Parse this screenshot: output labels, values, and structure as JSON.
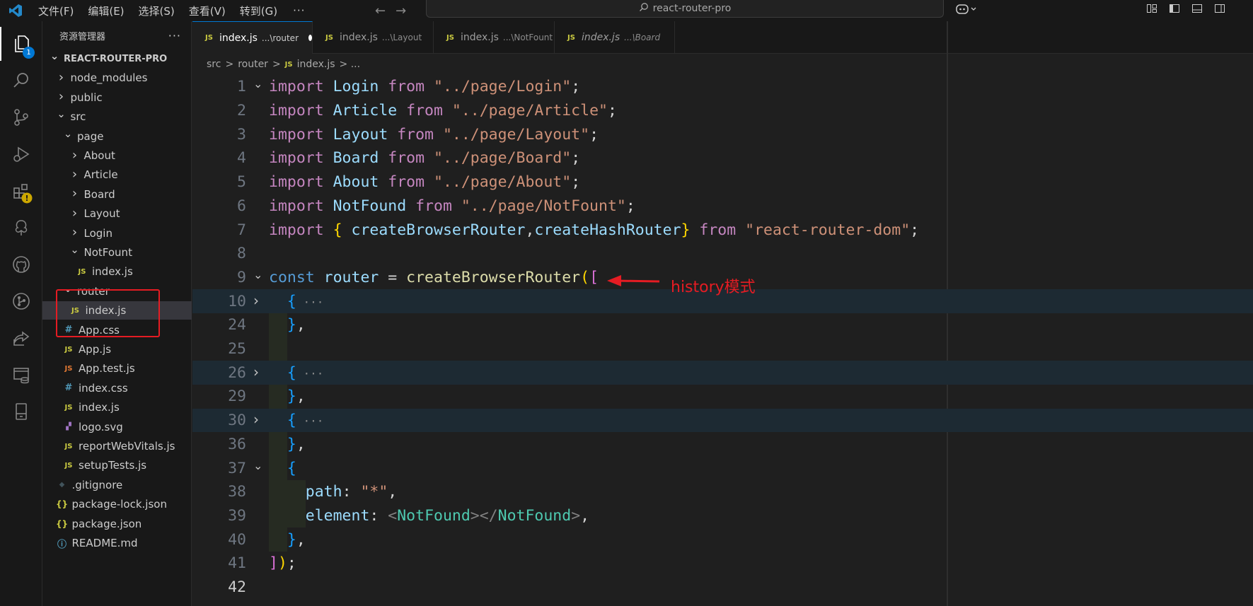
{
  "titlebar": {
    "menus": [
      "文件(F)",
      "编辑(E)",
      "选择(S)",
      "查看(V)",
      "转到(G)"
    ],
    "more": "···",
    "search_text": "react-router-pro"
  },
  "activity": {
    "explorer_badge": "1"
  },
  "sidebar": {
    "header": "资源管理器",
    "more": "···",
    "tree": [
      {
        "label": "REACT-ROUTER-PRO",
        "depth": 0,
        "chevron": "open",
        "icon": "",
        "root": true
      },
      {
        "label": "node_modules",
        "depth": 1,
        "chevron": "closed",
        "icon": ""
      },
      {
        "label": "public",
        "depth": 1,
        "chevron": "closed",
        "icon": ""
      },
      {
        "label": "src",
        "depth": 1,
        "chevron": "open",
        "icon": ""
      },
      {
        "label": "page",
        "depth": 2,
        "chevron": "open",
        "icon": ""
      },
      {
        "label": "About",
        "depth": 3,
        "chevron": "closed",
        "icon": ""
      },
      {
        "label": "Article",
        "depth": 3,
        "chevron": "closed",
        "icon": ""
      },
      {
        "label": "Board",
        "depth": 3,
        "chevron": "closed",
        "icon": ""
      },
      {
        "label": "Layout",
        "depth": 3,
        "chevron": "closed",
        "icon": ""
      },
      {
        "label": "Login",
        "depth": 3,
        "chevron": "closed",
        "icon": ""
      },
      {
        "label": "NotFount",
        "depth": 3,
        "chevron": "open",
        "icon": ""
      },
      {
        "label": "index.js",
        "depth": 4,
        "chevron": "",
        "icon": "js"
      },
      {
        "label": "router",
        "depth": 2,
        "chevron": "open",
        "icon": ""
      },
      {
        "label": "index.js",
        "depth": 3,
        "chevron": "",
        "icon": "js",
        "selected": true
      },
      {
        "label": "App.css",
        "depth": 2,
        "chevron": "",
        "icon": "css"
      },
      {
        "label": "App.js",
        "depth": 2,
        "chevron": "",
        "icon": "js"
      },
      {
        "label": "App.test.js",
        "depth": 2,
        "chevron": "",
        "icon": "jsorange"
      },
      {
        "label": "index.css",
        "depth": 2,
        "chevron": "",
        "icon": "css"
      },
      {
        "label": "index.js",
        "depth": 2,
        "chevron": "",
        "icon": "js"
      },
      {
        "label": "logo.svg",
        "depth": 2,
        "chevron": "",
        "icon": "svg"
      },
      {
        "label": "reportWebVitals.js",
        "depth": 2,
        "chevron": "",
        "icon": "js"
      },
      {
        "label": "setupTests.js",
        "depth": 2,
        "chevron": "",
        "icon": "js"
      },
      {
        "label": ".gitignore",
        "depth": 1,
        "chevron": "",
        "icon": "git"
      },
      {
        "label": "package-lock.json",
        "depth": 1,
        "chevron": "",
        "icon": "json"
      },
      {
        "label": "package.json",
        "depth": 1,
        "chevron": "",
        "icon": "json"
      },
      {
        "label": "README.md",
        "depth": 1,
        "chevron": "",
        "icon": "info"
      }
    ],
    "icon_glyphs": {
      "js": "JS",
      "css": "#",
      "jsorange": "JS",
      "svg": "▞",
      "git": "◆",
      "json": "{}",
      "info": "ⓘ"
    }
  },
  "tabs": [
    {
      "name": "index.js",
      "path": "...\\router",
      "active": true,
      "dirty": true
    },
    {
      "name": "index.js",
      "path": "...\\Layout"
    },
    {
      "name": "index.js",
      "path": "...\\NotFount"
    },
    {
      "name": "index.js",
      "path": "...\\Board",
      "italic": true
    }
  ],
  "breadcrumb": {
    "parts": [
      "src",
      ">",
      "router",
      ">"
    ],
    "js_badge": "JS",
    "file": "index.js",
    "tail": "> ..."
  },
  "code": [
    {
      "n": "1",
      "fold": "open",
      "t": [
        [
          "kw",
          "import "
        ],
        [
          "id",
          "Login "
        ],
        [
          "kw",
          "from "
        ],
        [
          "str",
          "\"../page/Login\""
        ],
        [
          "pl",
          ";"
        ]
      ]
    },
    {
      "n": "2",
      "fold": "",
      "t": [
        [
          "kw",
          "import "
        ],
        [
          "id",
          "Article "
        ],
        [
          "kw",
          "from "
        ],
        [
          "str",
          "\"../page/Article\""
        ],
        [
          "pl",
          ";"
        ]
      ]
    },
    {
      "n": "3",
      "fold": "",
      "t": [
        [
          "kw",
          "import "
        ],
        [
          "id",
          "Layout "
        ],
        [
          "kw",
          "from "
        ],
        [
          "str",
          "\"../page/Layout\""
        ],
        [
          "pl",
          ";"
        ]
      ]
    },
    {
      "n": "4",
      "fold": "",
      "t": [
        [
          "kw",
          "import "
        ],
        [
          "id",
          "Board "
        ],
        [
          "kw",
          "from "
        ],
        [
          "str",
          "\"../page/Board\""
        ],
        [
          "pl",
          ";"
        ]
      ]
    },
    {
      "n": "5",
      "fold": "",
      "t": [
        [
          "kw",
          "import "
        ],
        [
          "id",
          "About "
        ],
        [
          "kw",
          "from "
        ],
        [
          "str",
          "\"../page/About\""
        ],
        [
          "pl",
          ";"
        ]
      ]
    },
    {
      "n": "6",
      "fold": "",
      "t": [
        [
          "kw",
          "import "
        ],
        [
          "id",
          "NotFound "
        ],
        [
          "kw",
          "from "
        ],
        [
          "str",
          "\"../page/NotFount\""
        ],
        [
          "pl",
          ";"
        ]
      ]
    },
    {
      "n": "7",
      "fold": "",
      "t": [
        [
          "kw",
          "import "
        ],
        [
          "br1",
          "{ "
        ],
        [
          "id",
          "createBrowserRouter"
        ],
        [
          "pl",
          ","
        ],
        [
          "id",
          "createHashRouter"
        ],
        [
          "br1",
          "} "
        ],
        [
          "kw",
          "from "
        ],
        [
          "str",
          "\"react-router-dom\""
        ],
        [
          "pl",
          ";"
        ]
      ]
    },
    {
      "n": "8",
      "fold": "",
      "t": []
    },
    {
      "n": "9",
      "fold": "open",
      "t": [
        [
          "kwb",
          "const "
        ],
        [
          "id",
          "router "
        ],
        [
          "pl",
          "= "
        ],
        [
          "fn",
          "createBrowserRouter"
        ],
        [
          "br1",
          "("
        ],
        [
          "br2",
          "["
        ]
      ]
    },
    {
      "n": "10",
      "fold": "closed",
      "hl": true,
      "t": [
        [
          "pl",
          "  "
        ],
        [
          "br3",
          "{"
        ],
        [
          "ell",
          " ···"
        ]
      ]
    },
    {
      "n": "24",
      "fold": "",
      "t": [
        [
          "pl",
          "  "
        ],
        [
          "br3",
          "}"
        ],
        [
          "pl",
          ","
        ]
      ]
    },
    {
      "n": "25",
      "fold": "",
      "t": []
    },
    {
      "n": "26",
      "fold": "closed",
      "hl": true,
      "t": [
        [
          "pl",
          "  "
        ],
        [
          "br3",
          "{"
        ],
        [
          "ell",
          " ···"
        ]
      ]
    },
    {
      "n": "29",
      "fold": "",
      "t": [
        [
          "pl",
          "  "
        ],
        [
          "br3",
          "}"
        ],
        [
          "pl",
          ","
        ]
      ]
    },
    {
      "n": "30",
      "fold": "closed",
      "hl": true,
      "t": [
        [
          "pl",
          "  "
        ],
        [
          "br3",
          "{"
        ],
        [
          "ell",
          " ···"
        ]
      ]
    },
    {
      "n": "36",
      "fold": "",
      "t": [
        [
          "pl",
          "  "
        ],
        [
          "br3",
          "}"
        ],
        [
          "pl",
          ","
        ]
      ]
    },
    {
      "n": "37",
      "fold": "open",
      "t": [
        [
          "pl",
          "  "
        ],
        [
          "br3",
          "{"
        ]
      ]
    },
    {
      "n": "38",
      "fold": "",
      "t": [
        [
          "pl",
          "    "
        ],
        [
          "id",
          "path"
        ],
        [
          "pl",
          ": "
        ],
        [
          "str",
          "\"*\""
        ],
        [
          "pl",
          ","
        ]
      ]
    },
    {
      "n": "39",
      "fold": "",
      "t": [
        [
          "pl",
          "    "
        ],
        [
          "id",
          "element"
        ],
        [
          "pl",
          ": "
        ],
        [
          "tagp",
          "<"
        ],
        [
          "tag",
          "NotFound"
        ],
        [
          "tagp",
          "></"
        ],
        [
          "tag",
          "NotFound"
        ],
        [
          "tagp",
          ">"
        ],
        [
          "pl",
          ","
        ]
      ]
    },
    {
      "n": "40",
      "fold": "",
      "t": [
        [
          "pl",
          "  "
        ],
        [
          "br3",
          "}"
        ],
        [
          "pl",
          ","
        ]
      ]
    },
    {
      "n": "41",
      "fold": "",
      "t": [
        [
          "br2",
          "]"
        ],
        [
          "br1",
          ")"
        ],
        [
          "pl",
          ";"
        ]
      ]
    },
    {
      "n": "42",
      "fold": "",
      "cur": true,
      "t": []
    }
  ],
  "annotation": {
    "text": "history模式",
    "color": "#e51c23"
  },
  "colors": {
    "accent": "#0078d4",
    "annotation": "#e51c23"
  }
}
